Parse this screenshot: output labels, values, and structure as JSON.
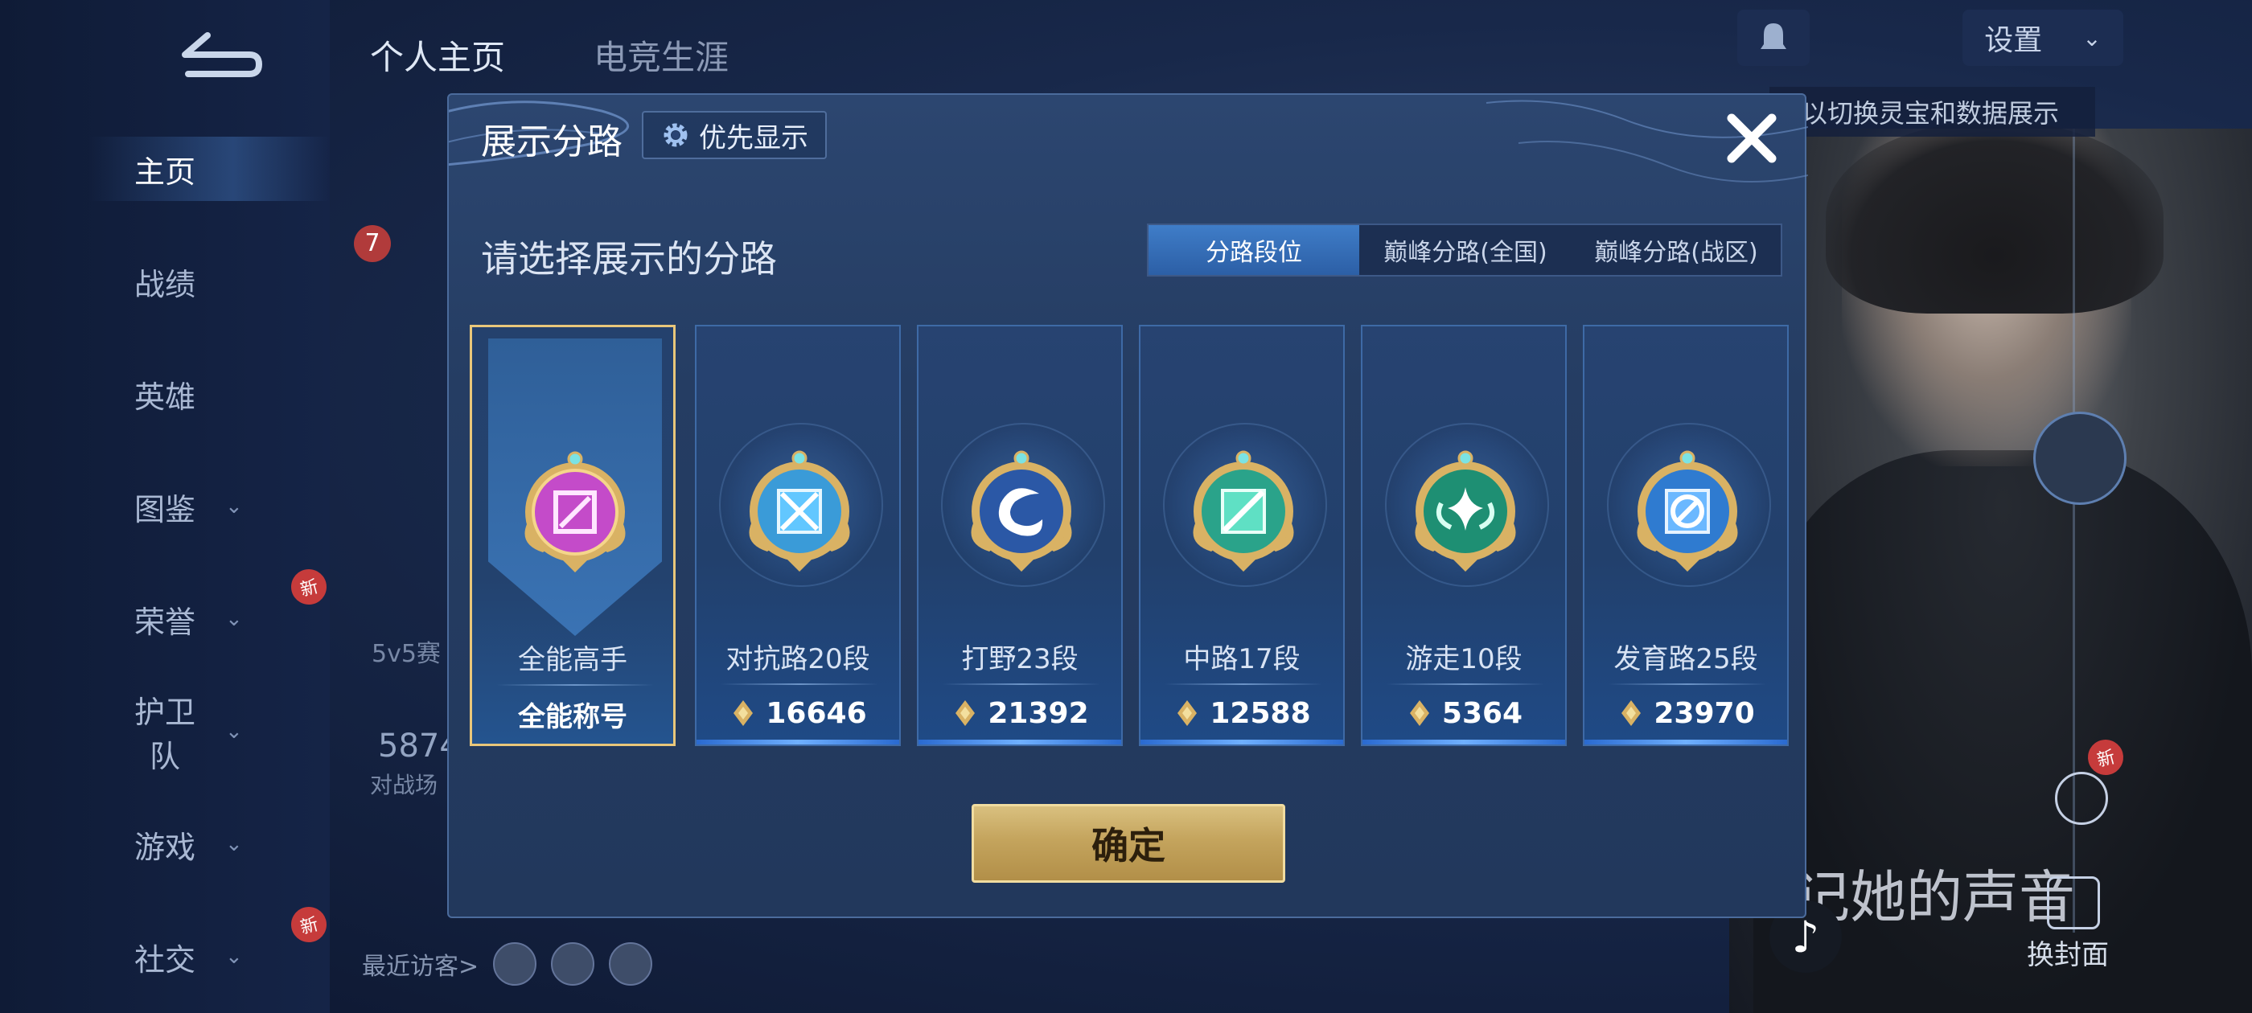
{
  "background": {
    "sidebar": {
      "items": [
        {
          "label": "主页",
          "has_chevron": false,
          "active": true
        },
        {
          "label": "战绩",
          "has_chevron": false
        },
        {
          "label": "英雄",
          "has_chevron": false
        },
        {
          "label": "图鉴",
          "has_chevron": true
        },
        {
          "label": "荣誉",
          "has_chevron": true,
          "new": true
        },
        {
          "label": "护卫队",
          "has_chevron": true
        },
        {
          "label": "游戏",
          "has_chevron": true
        },
        {
          "label": "社交",
          "has_chevron": true,
          "new": true
        }
      ],
      "new_badge": "新"
    },
    "top_tabs": [
      "个人主页",
      "电竞生涯"
    ],
    "settings_label": "设置",
    "hint_text": "以切换灵宝和数据展示",
    "song_text": "记她的声音",
    "cover_label": "换封面",
    "visitors_label": "最近访客>",
    "stat_number": "5874",
    "stat_label": "对战场",
    "mode_label": "5v5赛",
    "level_badge": "7"
  },
  "dialog": {
    "title": "展示分路",
    "priority_label": "优先显示",
    "subtitle": "请选择展示的分路",
    "tabs": [
      {
        "label": "分路段位",
        "active": true
      },
      {
        "label": "巅峰分路(全国)",
        "active": false
      },
      {
        "label": "巅峰分路(战区)",
        "active": false
      }
    ],
    "cards": [
      {
        "rank": "全能高手",
        "footer": "全能称号",
        "selected": true,
        "color": "#c44bc9",
        "icon": "allround-icon"
      },
      {
        "rank": "对抗路20段",
        "points": "16646",
        "color": "#3a9bd8",
        "icon": "clash-lane-icon"
      },
      {
        "rank": "打野23段",
        "points": "21392",
        "color": "#2b58a6",
        "icon": "jungle-icon"
      },
      {
        "rank": "中路17段",
        "points": "12588",
        "color": "#2aa38a",
        "icon": "mid-lane-icon"
      },
      {
        "rank": "游走10段",
        "points": "5364",
        "color": "#1e8f73",
        "icon": "roam-icon"
      },
      {
        "rank": "发育路25段",
        "points": "23970",
        "color": "#2f7bd0",
        "icon": "farm-lane-icon"
      }
    ],
    "confirm_label": "确定"
  },
  "colors": {
    "accent_gold": "#e9c77a",
    "tab_active": "#3f7dc8",
    "dialog_bg": "#253d63"
  }
}
